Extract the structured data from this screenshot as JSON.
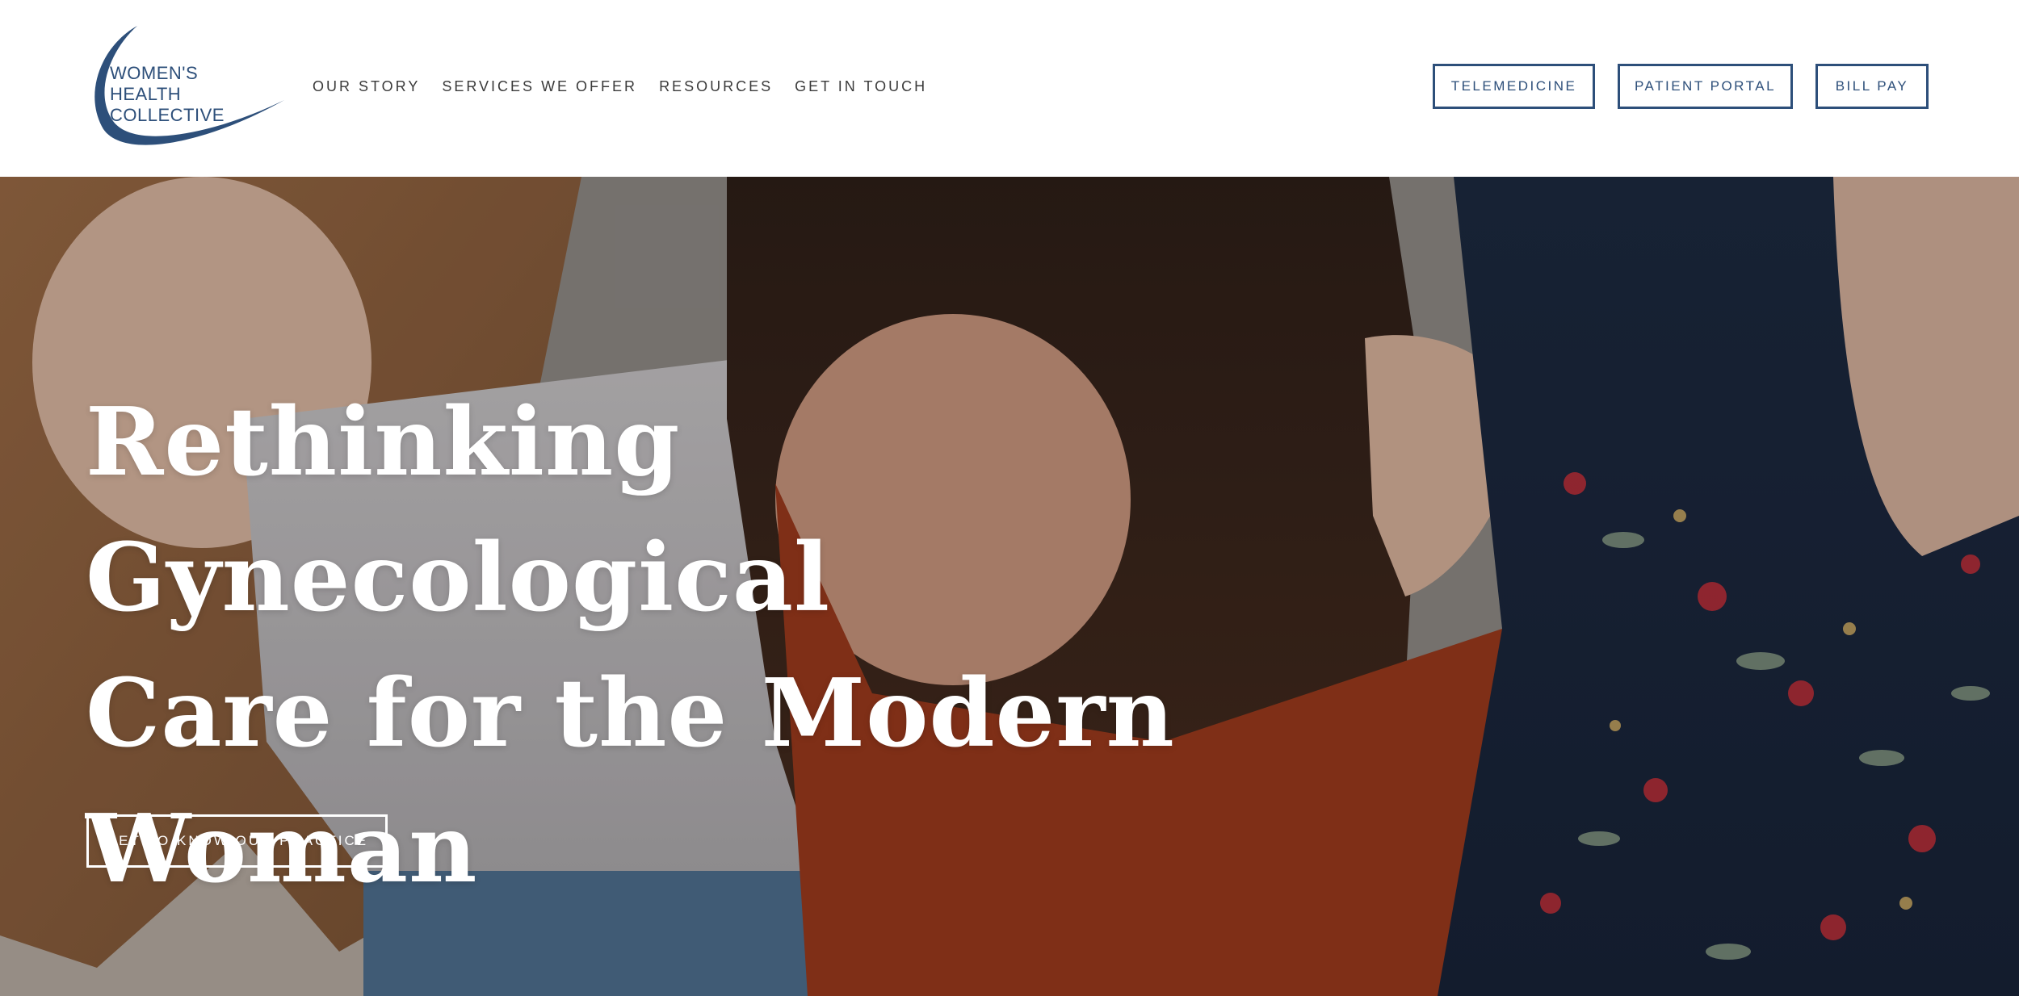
{
  "brand": {
    "logo_lines": [
      "WOMEN'S",
      "HEALTH",
      "COLLECTIVE"
    ],
    "logo_color": "#2d4f7a"
  },
  "nav": {
    "items": [
      {
        "label": "OUR STORY"
      },
      {
        "label": "SERVICES WE OFFER"
      },
      {
        "label": "RESOURCES"
      },
      {
        "label": "GET IN TOUCH"
      }
    ]
  },
  "header_buttons": {
    "telemedicine": "TELEMEDICINE",
    "patient_portal": "PATIENT PORTAL",
    "bill_pay": "BILL PAY"
  },
  "hero": {
    "title_lines": [
      "Rethinking Gynecological",
      "Care for the Modern",
      "Woman"
    ],
    "cta_label": "GET TO KNOW OUR PRACTICE",
    "accent_color": "#2d4f7a",
    "text_color": "#ffffff"
  }
}
